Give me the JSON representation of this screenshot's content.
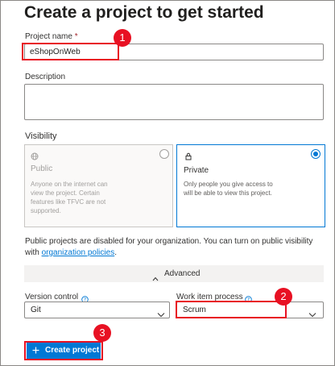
{
  "page": {
    "title": "Create a project to get started"
  },
  "project_name": {
    "label": "Project name",
    "required_marker": "*",
    "value": "eShopOnWeb"
  },
  "description": {
    "label": "Description",
    "value": ""
  },
  "visibility": {
    "label": "Visibility",
    "options": [
      {
        "title": "Public",
        "description": "Anyone on the internet can view the project. Certain features like TFVC are not supported.",
        "selected": false,
        "disabled": true,
        "icon": "globe-icon"
      },
      {
        "title": "Private",
        "description": "Only people you give access to will be able to view this project.",
        "selected": true,
        "disabled": false,
        "icon": "lock-icon"
      }
    ]
  },
  "notice": {
    "text": "Public projects are disabled for your organization. You can turn on public visibility with",
    "link": "organization policies",
    "suffix": "."
  },
  "advanced": {
    "label": "Advanced",
    "icon": "chevron-up-icon"
  },
  "version_control": {
    "label": "Version control",
    "value": "Git",
    "help_icon": "help-icon",
    "dropdown_icon": "chevron-down-icon"
  },
  "work_item_process": {
    "label": "Work item process",
    "value": "Scrum",
    "help_icon": "help-icon",
    "dropdown_icon": "chevron-down-icon"
  },
  "create_button": {
    "label": "Create project",
    "icon": "plus-icon"
  },
  "callouts": [
    "1",
    "2",
    "3"
  ],
  "colors": {
    "accent": "#0078d4",
    "callout": "#e81123",
    "text": "#323130"
  }
}
